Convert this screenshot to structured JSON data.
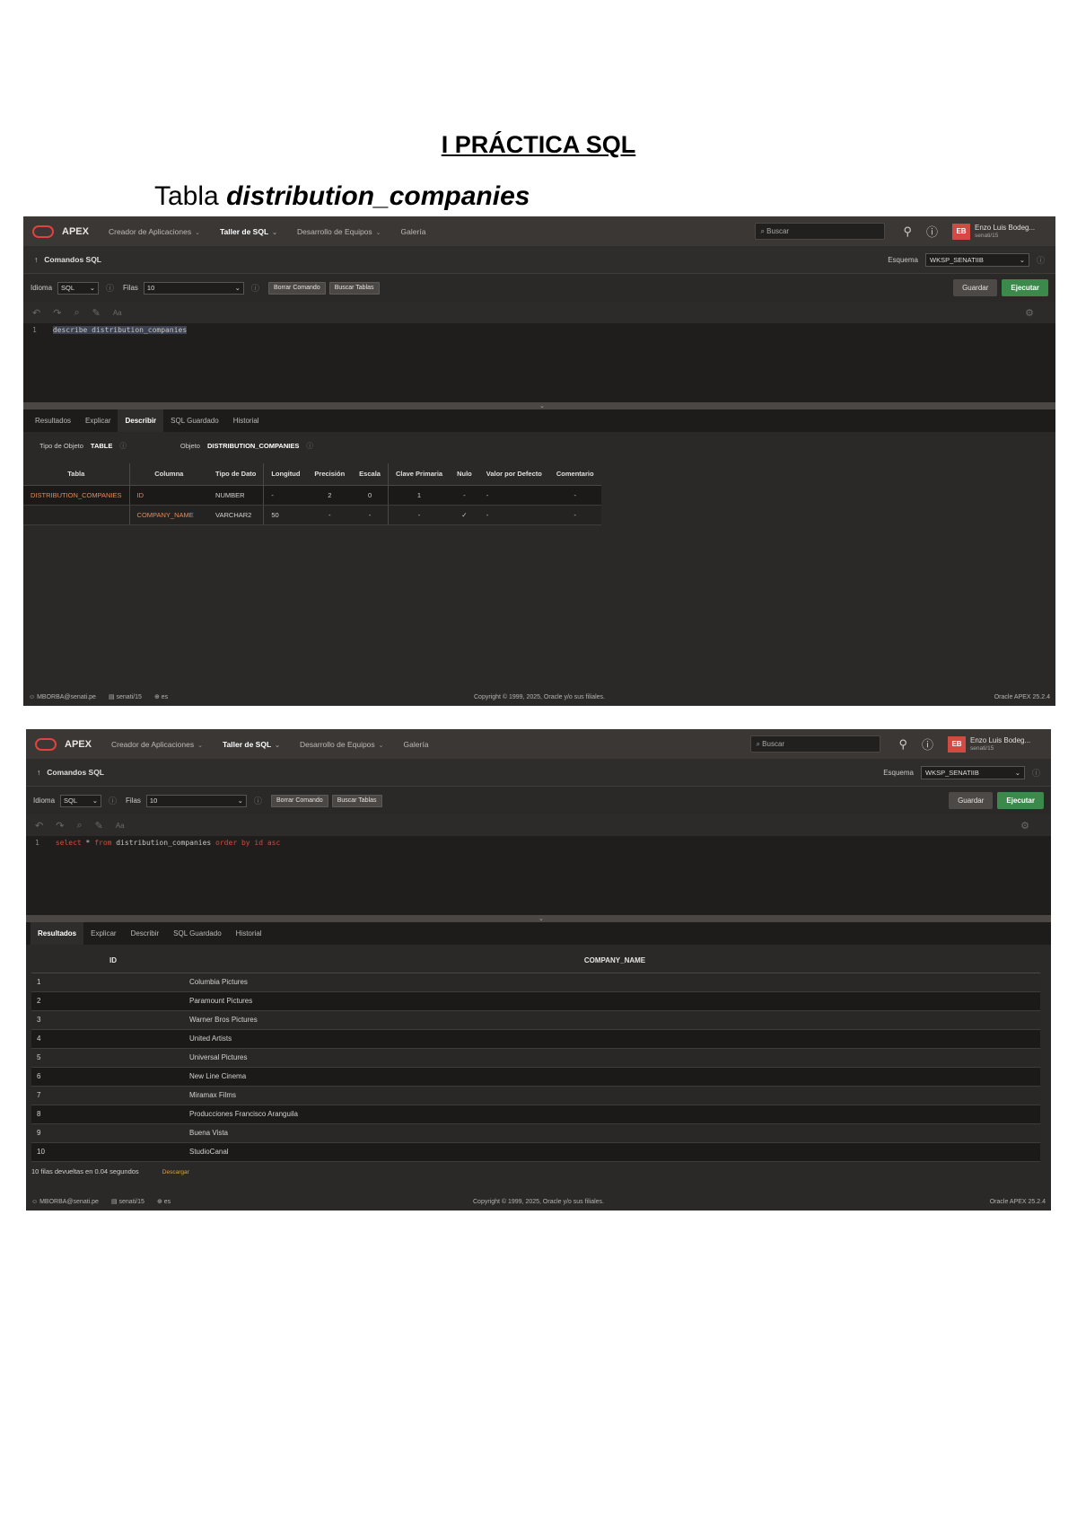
{
  "document": {
    "title": "I PRÁCTICA SQL",
    "subtitle_prefix": "Tabla",
    "subtitle_table": "distribution_companies"
  },
  "apex": {
    "brand": "APEX",
    "nav": [
      "Creador de Aplicaciones",
      "Taller de SQL",
      "Desarrollo de Equipos",
      "Galería"
    ],
    "search_placeholder": "Buscar",
    "avatar_initials": "EB",
    "user_name": "Enzo Luis Bodeg...",
    "user_sub": "senati/15",
    "page_title": "Comandos SQL",
    "schema_label": "Esquema",
    "schema_value": "WKSP_SENATIIB",
    "language_label": "Idioma",
    "language_value": "SQL",
    "rows_label": "Filas",
    "rows_value": "10",
    "clear_button": "Borrar Comando",
    "find_tables_button": "Buscar Tablas",
    "save_button": "Guardar",
    "run_button": "Ejecutar",
    "editor_aa": "Aa",
    "footer_user": "MBORBA@senati.pe",
    "footer_db": "senati/15",
    "footer_lang": "es",
    "copyright": "Copyright © 1999, 2025, Oracle y/o sus filiales.",
    "version": "Oracle APEX 25.2.4"
  },
  "shot1": {
    "line_no": "1",
    "query": "describe distribution_companies",
    "tabs": [
      "Resultados",
      "Explicar",
      "Describir",
      "SQL Guardado",
      "Historial"
    ],
    "active_tab": "Describir",
    "object_type_label": "Tipo de Objeto",
    "object_type_value": "TABLE",
    "object_label": "Objeto",
    "object_value": "DISTRIBUTION_COMPANIES",
    "columns": [
      "Tabla",
      "Columna",
      "Tipo de Dato",
      "Longitud",
      "Precisión",
      "Escala",
      "Clave Primaria",
      "Nulo",
      "Valor por Defecto",
      "Comentario"
    ],
    "rows": [
      [
        "DISTRIBUTION_COMPANIES",
        "ID",
        "NUMBER",
        "-",
        "2",
        "0",
        "1",
        "-",
        "-",
        "-"
      ],
      [
        "",
        "COMPANY_NAME",
        "VARCHAR2",
        "50",
        "-",
        "-",
        "-",
        "✓",
        "-",
        "-"
      ]
    ]
  },
  "shot2": {
    "line_no": "1",
    "query_kw1": "select",
    "query_mid1": " * ",
    "query_kw2": "from",
    "query_mid2": " distribution_companies ",
    "query_kw3": "order by id asc",
    "tabs": [
      "Resultados",
      "Explicar",
      "Describir",
      "SQL Guardado",
      "Historial"
    ],
    "active_tab": "Resultados",
    "columns": [
      "ID",
      "COMPANY_NAME"
    ],
    "rows": [
      [
        "1",
        "Columbia Pictures"
      ],
      [
        "2",
        "Paramount Pictures"
      ],
      [
        "3",
        "Warner Bros Pictures"
      ],
      [
        "4",
        "United Artists"
      ],
      [
        "5",
        "Universal Pictures"
      ],
      [
        "6",
        "New Line Cinema"
      ],
      [
        "7",
        "Miramax Films"
      ],
      [
        "8",
        "Producciones Francisco Aranguila"
      ],
      [
        "9",
        "Buena Vista"
      ],
      [
        "10",
        "StudioCanal"
      ]
    ],
    "summary": "10 filas devueltas en 0.04 segundos",
    "download": "Descargar"
  },
  "colors": {
    "apex_bg": "#2b2928",
    "apex_topbar": "#3a3735",
    "oracle_red": "#e0433b",
    "run_green": "#3b8a4b",
    "link_orange": "#e28a55"
  },
  "icons": [
    "oracle-logo-icon",
    "search-icon",
    "assistant-icon",
    "help-icon",
    "undo-icon",
    "redo-icon",
    "find-icon",
    "format-icon",
    "settings-icon",
    "user-icon",
    "database-icon",
    "globe-icon"
  ]
}
